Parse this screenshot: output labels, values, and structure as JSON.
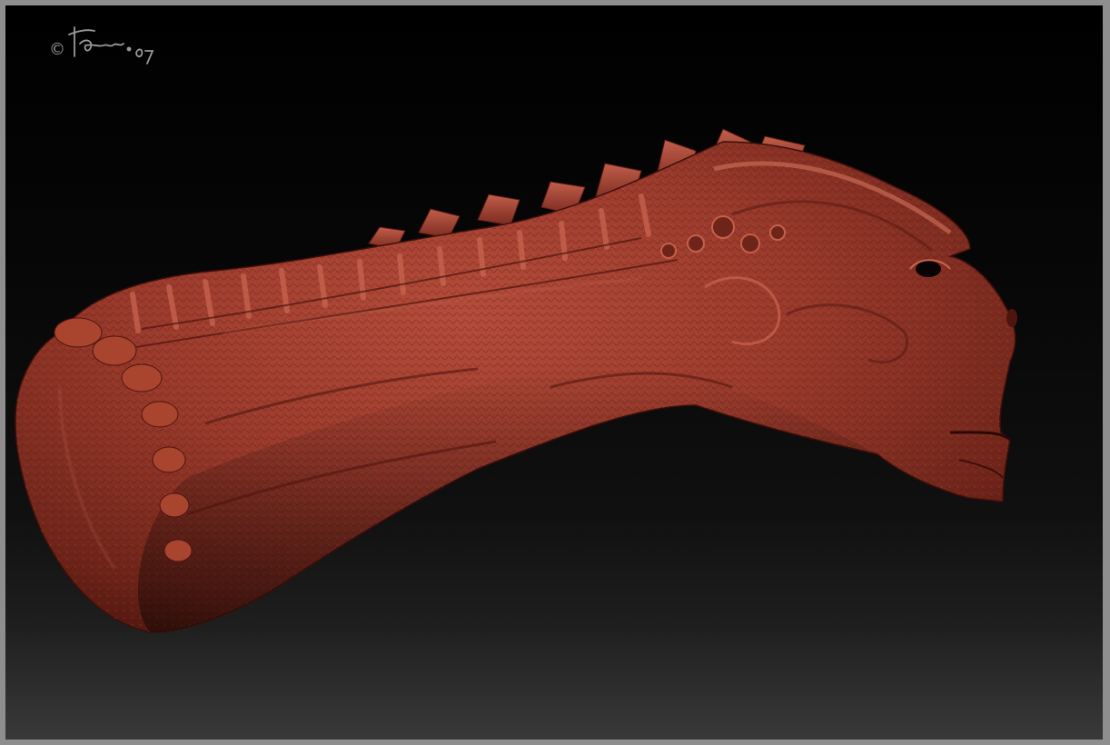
{
  "canvas": {
    "background_top": "#000000",
    "background_bottom": "#3a3a3a",
    "border_color": "#8e8e8e"
  },
  "subject": {
    "material_color": "#9a3a2c",
    "highlight_color": "#c05a48",
    "shadow_color": "#5a1a12"
  },
  "signature": {
    "symbol": "©",
    "handwriting": "Fabrizio 07",
    "color": "#9a9a9a"
  }
}
